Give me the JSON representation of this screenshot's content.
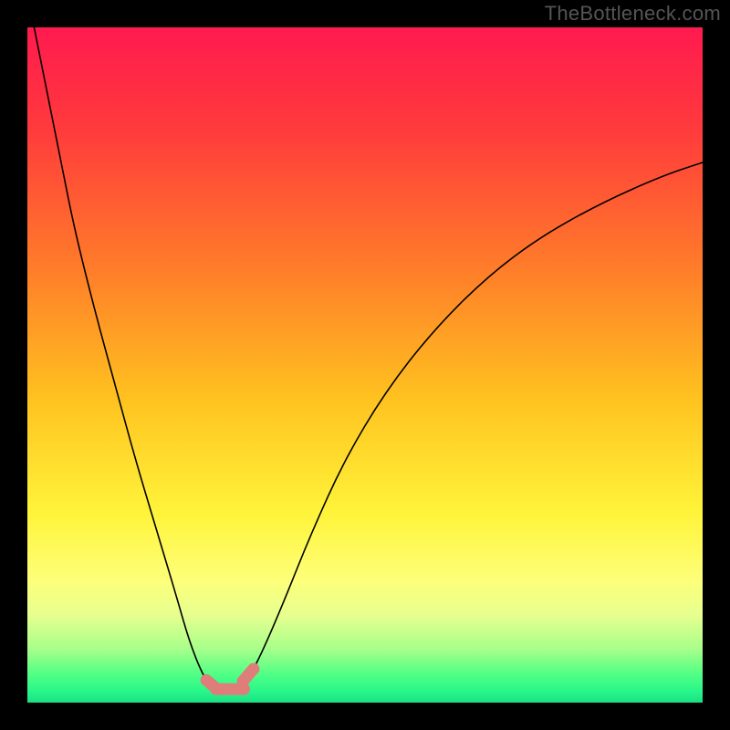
{
  "watermark": "TheBottleneck.com",
  "colors": {
    "frame": "#000000",
    "watermark": "#555555",
    "curve_stroke": "#000000",
    "bead_fill": "#df7d7b",
    "gradient_stops": [
      {
        "offset": 0.0,
        "color": "#ff1a4f"
      },
      {
        "offset": 0.15,
        "color": "#ff3a3c"
      },
      {
        "offset": 0.35,
        "color": "#ff7a2a"
      },
      {
        "offset": 0.55,
        "color": "#ffc21f"
      },
      {
        "offset": 0.72,
        "color": "#fff43a"
      },
      {
        "offset": 0.82,
        "color": "#fdff7a"
      },
      {
        "offset": 0.87,
        "color": "#e7ff8f"
      },
      {
        "offset": 0.92,
        "color": "#a8ff8a"
      },
      {
        "offset": 0.96,
        "color": "#4dff85"
      },
      {
        "offset": 0.985,
        "color": "#26f58a"
      },
      {
        "offset": 1.0,
        "color": "#1adf83"
      }
    ]
  },
  "chart_data": {
    "type": "line",
    "title": "",
    "xlabel": "",
    "ylabel": "",
    "xlim": [
      0,
      100
    ],
    "ylim": [
      0,
      100
    ],
    "legend": false,
    "grid": false,
    "series": [
      {
        "name": "bottleneck-curve",
        "x": [
          1,
          3,
          5,
          7,
          10,
          13,
          16,
          19,
          22,
          24,
          26,
          27.5,
          29,
          31,
          33,
          35,
          38,
          42,
          47,
          53,
          60,
          68,
          76,
          85,
          94,
          100
        ],
        "y": [
          100,
          90,
          80,
          70,
          58,
          47,
          36,
          26,
          16,
          9,
          4,
          2,
          2,
          2.5,
          4,
          8,
          15,
          25,
          36,
          46,
          55,
          63,
          69,
          74,
          78,
          80
        ]
      }
    ],
    "annotations": {
      "highlighted_range_x": [
        26.5,
        33.5
      ],
      "highlighted_meaning": "optimal / no bottleneck region (pink beads at curve minimum)"
    }
  }
}
